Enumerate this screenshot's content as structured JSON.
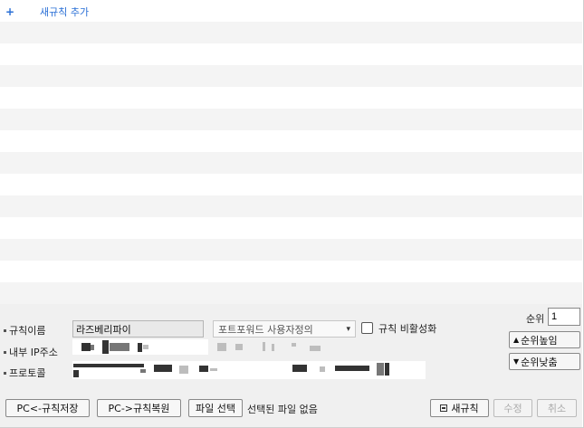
{
  "add_rule": {
    "icon": "+",
    "label": "새규칙 추가"
  },
  "rule_list": {
    "rows": 13
  },
  "editor": {
    "rule_name_label": "규칙이름",
    "rule_name_value": "라즈베리파이",
    "forward_type_value": "포트포워드 사용자정의",
    "disable_label": "규칙 비활성화",
    "internal_ip_label": "내부 IP주소",
    "protocol_label": "프로토콜",
    "rank_label": "순위",
    "rank_value": "1",
    "rank_up_label": "순위높임",
    "rank_down_label": "순위낮춤"
  },
  "footer": {
    "save_to_pc_label": "PC<-규칙저장",
    "restore_from_pc_label": "PC->규칙복원",
    "choose_file_label": "파일 선택",
    "no_file_label": "선택된 파일 없음",
    "new_rule_label": "새규칙",
    "modify_label": "수정",
    "cancel_label": "취소"
  }
}
